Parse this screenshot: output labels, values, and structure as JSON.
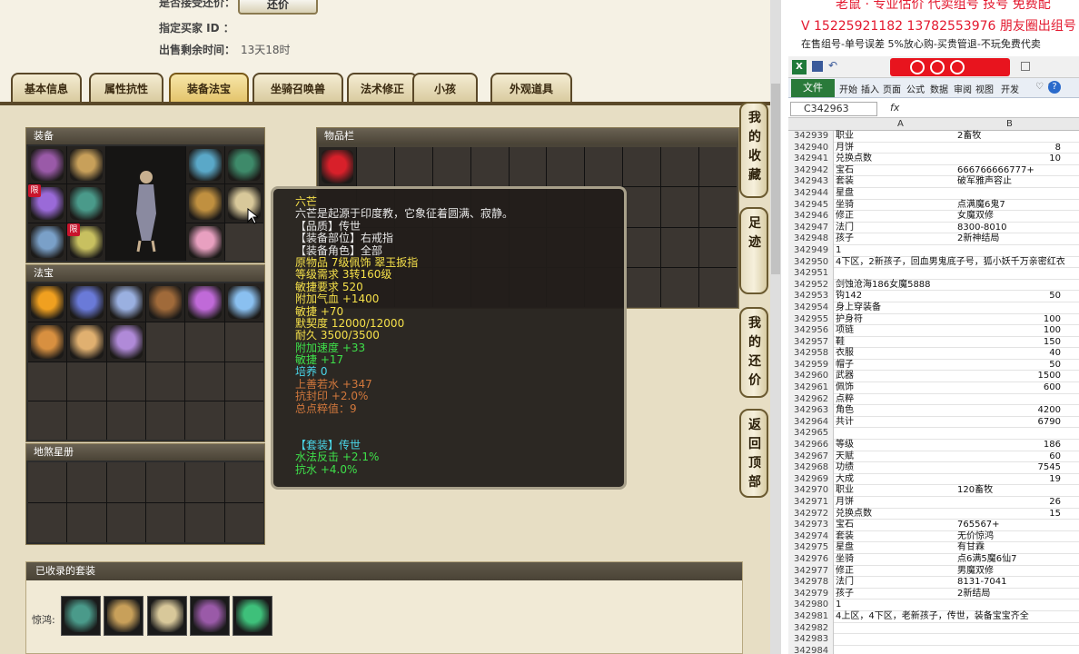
{
  "header": {
    "direct_bid_label": "是否接受还价：",
    "bid_button": "还价",
    "buyer_id_label": "指定买家 ID ：",
    "buyer_id_value": "",
    "time_left_label": "出售剩余时间：",
    "time_left_value": "13天18时"
  },
  "tabs": [
    "基本信息",
    "属性抗性",
    "装备法宝",
    "坐骑召唤兽",
    "法术修正",
    "小孩",
    "外观道具"
  ],
  "active_tab": 2,
  "sections": {
    "equipment": "装备",
    "inventory": "物品栏",
    "treasure": "法宝",
    "star_map": "地煞星册",
    "collected_suits": "已收录的套装",
    "suits_row_label": "惊鸿:"
  },
  "badge_text": "限",
  "tooltip": {
    "lines": [
      {
        "t": "六芒",
        "c": "#f5e04a"
      },
      {
        "t": "六芒是起源于印度教，它象征着圆满、寂静。",
        "c": "#e8e8e8"
      },
      {
        "t": "【品质】传世",
        "c": "#e8e8e8"
      },
      {
        "t": "【装备部位】右戒指",
        "c": "#e8e8e8"
      },
      {
        "t": "【装备角色】全部",
        "c": "#e8e8e8"
      },
      {
        "t": "原物品 7级佩饰 翠玉扳指",
        "c": "#f5e04a"
      },
      {
        "t": "等级需求 3转160级",
        "c": "#f5e04a"
      },
      {
        "t": "敏捷要求 520",
        "c": "#f5e04a"
      },
      {
        "t": "附加气血 +1400",
        "c": "#f5e04a"
      },
      {
        "t": "敏捷 +70",
        "c": "#f5e04a"
      },
      {
        "t": "默契度 12000/12000",
        "c": "#f5e04a"
      },
      {
        "t": "耐久 3500/3500",
        "c": "#f5e04a"
      },
      {
        "t": "附加速度 +33",
        "c": "#3ee04a"
      },
      {
        "t": "敏捷 +17",
        "c": "#3ee04a"
      },
      {
        "t": "培养 0",
        "c": "#4ad6e8"
      },
      {
        "t": "上善若水 +347",
        "c": "#d2783c"
      },
      {
        "t": "抗封印 +2.0%",
        "c": "#d2783c"
      },
      {
        "t": "总点粹值：9",
        "c": "#d2783c"
      },
      {
        "t": "",
        "c": "#e8e8e8"
      },
      {
        "t": "",
        "c": "#e8e8e8"
      },
      {
        "t": "【套装】传世",
        "c": "#4ad6e8"
      },
      {
        "t": "水法反击 +2.1%",
        "c": "#3ee04a"
      },
      {
        "t": "抗水 +4.0%",
        "c": "#3ee04a"
      }
    ]
  },
  "side_nav": [
    "我的收藏",
    "足迹",
    "我的还价",
    "返回顶部"
  ],
  "colors": {
    "equip_icons": [
      "#9a5aa8",
      "#c8a05a",
      "#5aa8c8",
      "#3e8a6a",
      "#9a6ad8",
      "#4a9a8a",
      "#c09040",
      "#d8c89a",
      "#7aa0c8",
      "#c8c060",
      "#e8a0c0"
    ],
    "treasure_icons": [
      "#f0a020",
      "#6a7ad8",
      "#9ab0e0",
      "#a06a3a",
      "#c06ad8",
      "#8ac0f0",
      "#d89040",
      "#e0b070",
      "#b08ad8"
    ],
    "suit_icons": [
      "#4a9a8a",
      "#c8a05a",
      "#d8c89a",
      "#9a5aa8",
      "#3ec07a"
    ]
  },
  "spreadsheet": {
    "ads": {
      "top": "老鼠 · 专业估价 代卖组号 技号 免费配",
      "phones": "V 15225921182   13782553976 朋友圈出组号",
      "notice": "在售组号-单号误差 5%放心购-买贵管退-不玩免费代卖"
    },
    "ribbon_file": "文件",
    "ribbon_tabs": [
      "开始",
      "插入",
      "页面",
      "公式",
      "数据",
      "审阅",
      "视图",
      "开发"
    ],
    "name_box": "C342963",
    "fx": "fx",
    "col_a": "A",
    "col_b": "B",
    "rows": [
      [
        "342939",
        "职业",
        "2畜牧",
        false
      ],
      [
        "342940",
        "月饼",
        "8",
        true
      ],
      [
        "342941",
        "兑换点数",
        "10",
        true
      ],
      [
        "342942",
        "宝石",
        "666766666777+",
        false
      ],
      [
        "342943",
        "套装",
        "破军雅声容止",
        false
      ],
      [
        "342944",
        "星盘",
        "",
        false
      ],
      [
        "342945",
        "坐骑",
        "点满魔6鬼7",
        false
      ],
      [
        "342946",
        "修正",
        "女魔双修",
        false
      ],
      [
        "342947",
        "法门",
        "8300-8010",
        false
      ],
      [
        "342948",
        "孩子",
        "2新神结局",
        false
      ],
      [
        "342949",
        "            1",
        "",
        false
      ],
      [
        "342950",
        "4下区，2新孩子，回血男鬼底子号，狐小妖千万亲密红衣",
        "",
        false
      ],
      [
        "342951",
        "",
        "",
        false
      ],
      [
        "342952",
        "剑蚀沧海186女魔5888",
        "",
        false
      ],
      [
        "342953",
        "钩142",
        "50",
        true
      ],
      [
        "342954",
        "身上穿装备",
        "",
        false
      ],
      [
        "342955",
        "护身符",
        "100",
        true
      ],
      [
        "342956",
        "项链",
        "100",
        true
      ],
      [
        "342957",
        "鞋",
        "150",
        true
      ],
      [
        "342958",
        "衣服",
        "40",
        true
      ],
      [
        "342959",
        "帽子",
        "50",
        true
      ],
      [
        "342960",
        "武器",
        "1500",
        true
      ],
      [
        "342961",
        "佩饰",
        "600",
        true
      ],
      [
        "342962",
        "点粹",
        "",
        false
      ],
      [
        "342963",
        "角色",
        "4200",
        true
      ],
      [
        "342964",
        "共计",
        "6790",
        true
      ],
      [
        "342965",
        "",
        "",
        false
      ],
      [
        "342966",
        "等级",
        "186",
        true
      ],
      [
        "342967",
        "天赋",
        "60",
        true
      ],
      [
        "342968",
        "功绩",
        "7545",
        true
      ],
      [
        "342969",
        "大成",
        "19",
        true
      ],
      [
        "342970",
        "职业",
        "120畜牧",
        false
      ],
      [
        "342971",
        "月饼",
        "26",
        true
      ],
      [
        "342972",
        "兑换点数",
        "15",
        true
      ],
      [
        "342973",
        "宝石",
        "765567+",
        false
      ],
      [
        "342974",
        "套装",
        "无价惊鸿",
        false
      ],
      [
        "342975",
        "星盘",
        "有甘霖",
        false
      ],
      [
        "342976",
        "坐骑",
        "点6满5魔6仙7",
        false
      ],
      [
        "342977",
        "修正",
        "男魔双修",
        false
      ],
      [
        "342978",
        "法门",
        "8131-7041",
        false
      ],
      [
        "342979",
        "孩子",
        "2新结局",
        false
      ],
      [
        "342980",
        "            1",
        "",
        false
      ],
      [
        "342981",
        "4上区，4下区，老新孩子，传世，装备宝宝齐全",
        "",
        false
      ],
      [
        "342982",
        "",
        "",
        false
      ],
      [
        "342983",
        "",
        "",
        false
      ],
      [
        "342984",
        "",
        "",
        false
      ]
    ]
  }
}
